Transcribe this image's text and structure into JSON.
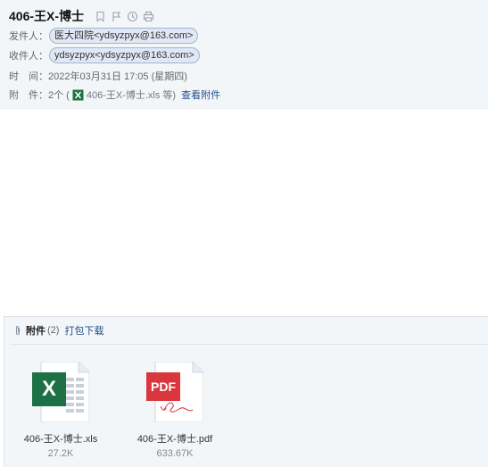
{
  "subject": "406-王X-博士",
  "colors": {
    "accent": "#1f4e8c",
    "chip_bg": "#dfe8f4",
    "chip_border": "#9fb6d2",
    "excel_green": "#1e7145",
    "pdf_red": "#d9363e"
  },
  "header_icons": [
    "bookmark-icon",
    "flag-icon",
    "clock-icon",
    "print-icon"
  ],
  "sender": {
    "label": "发件人：",
    "chip": "医大四院<ydsyzpyx@163.com>"
  },
  "recipient": {
    "label": "收件人：",
    "chip": "ydsyzpyx<ydsyzpyx@163.com>"
  },
  "time": {
    "label": "时　间：",
    "value": "2022年03月31日 17:05 (星期四)"
  },
  "attachments_line": {
    "label": "附　件：",
    "count_text": "2个 (",
    "file_text": "406-王X-博士.xls 等)",
    "view_link": "查看附件"
  },
  "attachment_panel": {
    "title": "附件",
    "count": "(2)",
    "pack_download": "打包下载",
    "files": [
      {
        "name": "406-王X-博士.xls",
        "size": "27.2K",
        "icon": "excel-file-icon",
        "badge": "X"
      },
      {
        "name": "406-王X-博士.pdf",
        "size": "633.67K",
        "icon": "pdf-file-icon",
        "badge": "PDF"
      }
    ]
  }
}
